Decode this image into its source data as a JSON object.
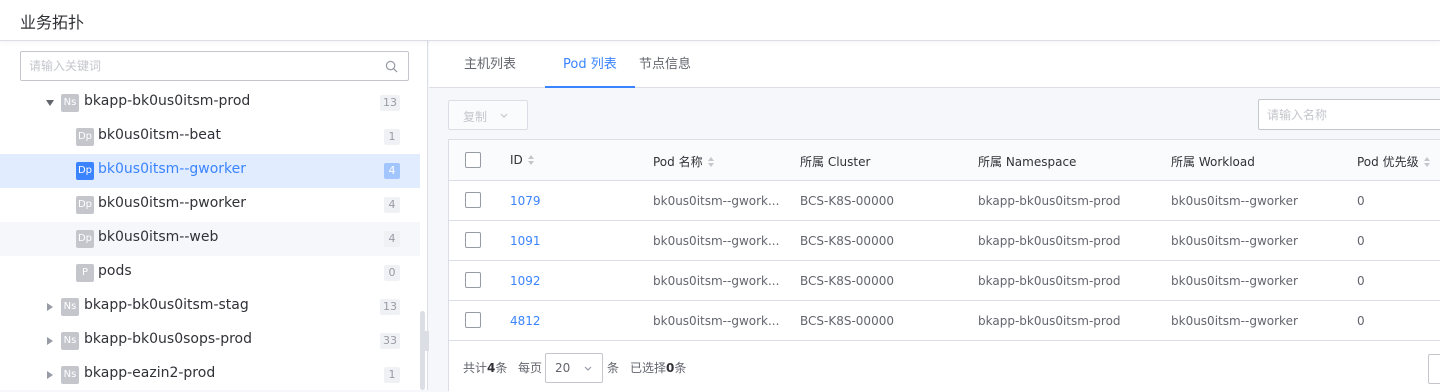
{
  "header": {
    "title": "业务拓扑"
  },
  "sidebar": {
    "search_placeholder": "请输入关键词",
    "items": [
      {
        "type": "Ns",
        "label": "bkapp-bk0us0itsm-prod",
        "count": "13",
        "expanded": true
      },
      {
        "type": "Dp",
        "label": "bk0us0itsm--beat",
        "count": "1"
      },
      {
        "type": "Dp",
        "label": "bk0us0itsm--gworker",
        "count": "4",
        "selected": true
      },
      {
        "type": "Dp",
        "label": "bk0us0itsm--pworker",
        "count": "4"
      },
      {
        "type": "Dp",
        "label": "bk0us0itsm--web",
        "count": "4"
      },
      {
        "type": "P",
        "label": "pods",
        "count": "0"
      },
      {
        "type": "Ns",
        "label": "bkapp-bk0us0itsm-stag",
        "count": "13"
      },
      {
        "type": "Ns",
        "label": "bkapp-bk0us0sops-prod",
        "count": "33"
      },
      {
        "type": "Ns",
        "label": "bkapp-eazin2-prod",
        "count": "1"
      }
    ]
  },
  "tabs": [
    {
      "label": "主机列表"
    },
    {
      "label": "Pod 列表",
      "active": true
    },
    {
      "label": "节点信息"
    }
  ],
  "toolbar": {
    "copy_label": "复制",
    "name_search_placeholder": "请输入名称"
  },
  "table": {
    "columns": [
      "ID",
      "Pod 名称",
      "所属 Cluster",
      "所属 Namespace",
      "所属 Workload",
      "Pod 优先级"
    ],
    "rows": [
      {
        "id": "1079",
        "pod_name": "bk0us0itsm--gwork...",
        "cluster": "BCS-K8S-00000",
        "namespace": "bkapp-bk0us0itsm-prod",
        "workload": "bk0us0itsm--gworker",
        "priority": "0"
      },
      {
        "id": "1091",
        "pod_name": "bk0us0itsm--gwork...",
        "cluster": "BCS-K8S-00000",
        "namespace": "bkapp-bk0us0itsm-prod",
        "workload": "bk0us0itsm--gworker",
        "priority": "0"
      },
      {
        "id": "1092",
        "pod_name": "bk0us0itsm--gwork...",
        "cluster": "BCS-K8S-00000",
        "namespace": "bkapp-bk0us0itsm-prod",
        "workload": "bk0us0itsm--gworker",
        "priority": "0"
      },
      {
        "id": "4812",
        "pod_name": "bk0us0itsm--gwork...",
        "cluster": "BCS-K8S-00000",
        "namespace": "bkapp-bk0us0itsm-prod",
        "workload": "bk0us0itsm--gworker",
        "priority": "0"
      }
    ]
  },
  "pagination": {
    "total_prefix": "共计",
    "total": "4",
    "total_suffix": "条",
    "per_page_label": "每页",
    "page_size": "20",
    "page_size_suffix": "条",
    "selected_prefix": "已选择",
    "selected": "0",
    "selected_suffix": "条"
  },
  "colors": {
    "accent": "#3a84ff",
    "tag_gray": "#c4c6cc",
    "border": "#dcdee5"
  }
}
